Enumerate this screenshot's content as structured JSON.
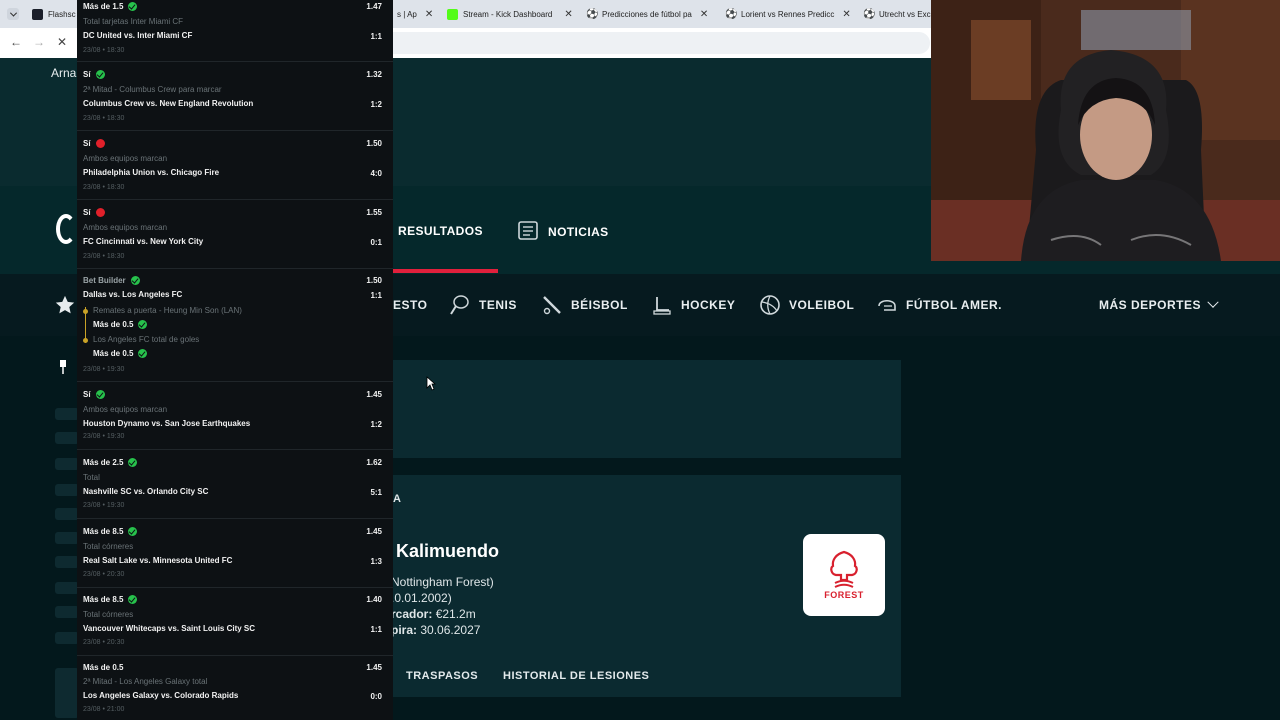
{
  "browser": {
    "tabs": [
      {
        "label": "Flashsco",
        "color": "#1b1f2a"
      },
      {
        "label": "s | Ap",
        "color": "#dee3ea"
      },
      {
        "label": "Stream - Kick Dashboard",
        "color": "#53fc18"
      },
      {
        "label": "Predicciones de fútbol pa",
        "color": "#e23b3b"
      },
      {
        "label": "Lorient vs Rennes Predicc",
        "color": "#e23b3b"
      },
      {
        "label": "Utrecht vs Exce",
        "color": "#e23b3b"
      }
    ]
  },
  "page": {
    "header_user": "Arna",
    "main_tabs": {
      "results": "RESULTADOS",
      "news": "NOTICIAS"
    },
    "sports": [
      {
        "label": "ESTO",
        "icon": "basketball-icon"
      },
      {
        "label": "TENIS",
        "icon": "tennis-icon"
      },
      {
        "label": "BÉISBOL",
        "icon": "baseball-icon"
      },
      {
        "label": "HOCKEY",
        "icon": "hockey-icon"
      },
      {
        "label": "VOLEIBOL",
        "icon": "volleyball-icon"
      },
      {
        "label": "FÚTBOL AMER.",
        "icon": "american-football-icon"
      }
    ],
    "more_sports": "MÁS DEPORTES",
    "player": {
      "fragment": "A",
      "name": "Kalimuendo",
      "club_line": "Nottingham Forest)",
      "birth_line": ".0.01.2002)",
      "value_label": "rcador:",
      "value": "€21.2m",
      "expiry_label": "pira:",
      "expiry": "30.06.2027",
      "club_badge_text": "FOREST"
    },
    "subtabs": [
      "TRASPASOS",
      "HISTORIAL DE LESIONES"
    ]
  },
  "bet_slip": [
    {
      "title": "Más de 1.5",
      "status": "won",
      "market": "Total tarjetas Inter Miami CF",
      "match": "DC United vs. Inter Miami CF",
      "odd": "1.47",
      "score": "1:1",
      "date": "23/08 • 18:30"
    },
    {
      "title": "Sí",
      "status": "won",
      "market": "2ª Mitad - Columbus Crew para marcar",
      "match": "Columbus Crew vs. New England Revolution",
      "odd": "1.32",
      "score": "1:2",
      "date": "23/08 • 18:30"
    },
    {
      "title": "Sí",
      "status": "lost",
      "market": "Ambos equipos marcan",
      "match": "Philadelphia Union vs. Chicago Fire",
      "odd": "1.50",
      "score": "4:0",
      "date": "23/08 • 18:30"
    },
    {
      "title": "Sí",
      "status": "lost",
      "market": "Ambos equipos marcan",
      "match": "FC Cincinnati vs. New York City",
      "odd": "1.55",
      "score": "0:1",
      "date": "23/08 • 18:30"
    },
    {
      "title": "Bet Builder",
      "status": "won",
      "match": "Dallas vs. Los Angeles FC",
      "odd": "1.50",
      "score": "1:1",
      "date": "23/08 • 19:30",
      "legs": [
        {
          "market": "Remates a puerta - Heung Min Son (LAN)",
          "pick": "Más de 0.5"
        },
        {
          "market": "Los Angeles FC total de goles",
          "pick": "Más de 0.5"
        }
      ]
    },
    {
      "title": "Sí",
      "status": "won",
      "market": "Ambos equipos marcan",
      "match": "Houston Dynamo vs. San Jose Earthquakes",
      "odd": "1.45",
      "score": "1:2",
      "date": "23/08 • 19:30"
    },
    {
      "title": "Más de 2.5",
      "status": "won",
      "market": "Total",
      "match": "Nashville SC vs. Orlando City SC",
      "odd": "1.62",
      "score": "5:1",
      "date": "23/08 • 19:30"
    },
    {
      "title": "Más de 8.5",
      "status": "won",
      "market": "Total córneres",
      "match": "Real Salt Lake vs. Minnesota United FC",
      "odd": "1.45",
      "score": "1:3",
      "date": "23/08 • 20:30"
    },
    {
      "title": "Más de 8.5",
      "status": "won",
      "market": "Total córneres",
      "match": "Vancouver Whitecaps vs. Saint Louis City SC",
      "odd": "1.40",
      "score": "1:1",
      "date": "23/08 • 20:30"
    },
    {
      "title": "Más de 0.5",
      "status": "",
      "market": "2ª Mitad - Los Angeles Galaxy total",
      "match": "Los Angeles Galaxy vs. Colorado Rapids",
      "odd": "1.45",
      "score": "0:0",
      "date": "23/08 • 21:00"
    }
  ]
}
